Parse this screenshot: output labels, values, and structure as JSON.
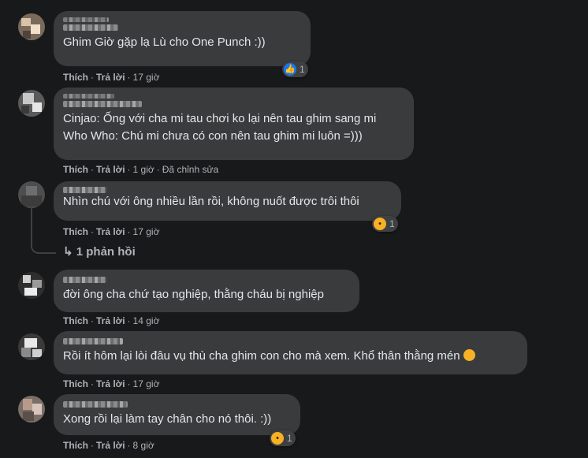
{
  "labels": {
    "like": "Thích",
    "reply": "Trả lời",
    "sep": "·"
  },
  "comments": [
    {
      "text": "Ghim   Giờ gặp lạ Lù cho One Punch :))",
      "time": "17 giờ",
      "edited": "",
      "reaction": {
        "icon": "like-icon",
        "count": "1"
      }
    },
    {
      "text_lines": [
        "Cinjao: Ống với cha mi tau chơi ko lại nên tau ghim sang mi",
        "Who Who: Chú mi chưa có con nên tau ghim mi luôn =)))"
      ],
      "time": "1 giờ",
      "edited": "Đã chỉnh sửa"
    },
    {
      "text": "Nhìn chú với ông nhiều lần rồi, không nuốt được trôi thôi",
      "time": "17 giờ",
      "reaction": {
        "icon": "wow-icon",
        "count": "1"
      }
    },
    {
      "text": "đời ông cha chứ tạo nghiệp, thằng cháu bị nghiệp",
      "time": "14 giờ"
    },
    {
      "text": "Rồi ít hôm lại lòi đâu vụ thù cha ghim con cho mà xem. Khổ thân thằng mén",
      "time": "17 giờ"
    },
    {
      "text": "Xong rồi lại làm tay chân cho nó thôi. :))",
      "time": "8 giờ",
      "reaction": {
        "icon": "haha-icon",
        "count": "1"
      }
    }
  ],
  "reply_link": "↳ 1 phản hồi",
  "colors": {
    "background": "#18191a",
    "bubble": "#3a3b3c",
    "text": "#e4e6eb",
    "secondary": "#b0b3b8",
    "like_blue": "#1877f2"
  }
}
